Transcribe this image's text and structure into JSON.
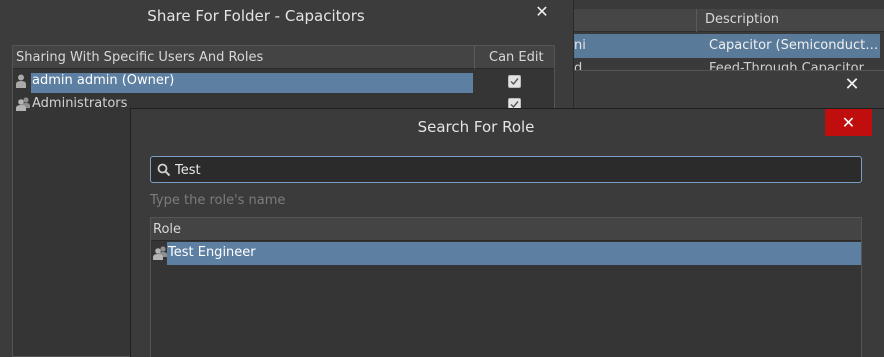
{
  "background_table": {
    "header_description": "Description",
    "selected_row": {
      "name_fragment": "ni",
      "description": "Capacitor (Semiconduct…"
    },
    "next_row": {
      "name_fragment": "d",
      "description": "Feed-Through Capacitor"
    }
  },
  "middle_dialog": {
    "close_glyph": "✕"
  },
  "share_dialog": {
    "title": "Share For Folder - Capacitors",
    "close_glyph": "✕",
    "columns": {
      "users": "Sharing With Specific Users And Roles",
      "can_edit": "Can Edit"
    },
    "rows": [
      {
        "label": "admin admin (Owner)",
        "icon": "user-icon",
        "can_edit": true,
        "selected": true
      },
      {
        "label": "Administrators",
        "icon": "group-icon",
        "can_edit": true,
        "selected": false
      }
    ]
  },
  "search_dialog": {
    "title": "Search For Role",
    "close_glyph": "✕",
    "search_value": "Test",
    "hint": "Type the role's name",
    "list_header": "Role",
    "results": [
      {
        "label": "Test Engineer",
        "icon": "group-icon",
        "selected": true
      }
    ]
  },
  "colors": {
    "selection": "#5d7fa1",
    "close_button_red": "#c00d0d",
    "focus_border": "#7aa0c6"
  }
}
